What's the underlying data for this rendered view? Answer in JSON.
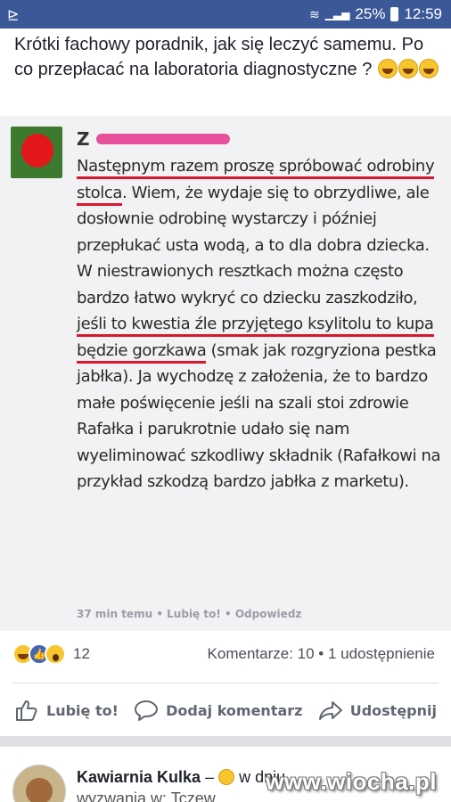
{
  "status_bar": {
    "battery": "25%",
    "time": "12:59",
    "left_icon": "app-notification-icon",
    "wifi_icon": "wifi-icon",
    "signal_icon": "signal-icon"
  },
  "post": {
    "caption": "Krótki fachowy poradnik, jak się leczyć samemu. Po co przepłacać na laboratoria diagnostyczne ?",
    "caption_emojis": [
      "laughing-tears-emoji",
      "laughing-tears-emoji",
      "laughing-tears-emoji"
    ]
  },
  "comment": {
    "author_initial": "Z",
    "segments": [
      {
        "text": "Następnym razem proszę spróbować odrobiny stolca",
        "highlight": true
      },
      {
        "text": ". Wiem, że wydaje się to obrzydliwe, ale dosłownie odrobinę wystarczy i później przepłukać usta wodą, a to dla dobra dziecka. W niestrawionych resztkach można często bardzo łatwo wykryć co dziecku zaszkodziło, ",
        "highlight": false
      },
      {
        "text": "jeśli to kwestia źle przyjętego ksylitolu to kupa będzie gorzkawa",
        "highlight": true
      },
      {
        "text": " (smak jak rozgryziona pestka jabłka). Ja wychodzę z założenia, że to bardzo małe poświęcenie jeśli na szali stoi zdrowie Rafałka i parukrotnie udało się nam wyeliminować szkodliwy składnik (Rafałkowi na przykład szkodzą bardzo jabłka z marketu).",
        "highlight": false
      }
    ],
    "meta": "37 min temu  •  Lubię to!  •  Odpowiedz"
  },
  "reactions": {
    "icons": [
      "haha-reaction-icon",
      "like-reaction-icon",
      "wow-reaction-icon"
    ],
    "count": "12",
    "stats": "Komentarze: 10 • 1 udostępnienie"
  },
  "actions": {
    "like": "Lubię to!",
    "comment": "Dodaj komentarz",
    "share": "Udostępnij"
  },
  "next_post": {
    "page_name": "Kawiarnia Kulka",
    "dash": " – ",
    "rest": " w dniu ...",
    "line2": "wyzwania w: Tczew"
  },
  "watermark": "www.wiocha.pl",
  "colors": {
    "facebook_blue": "#3b5998",
    "highlight_red": "#d8162c",
    "text_gray": "#606770"
  }
}
